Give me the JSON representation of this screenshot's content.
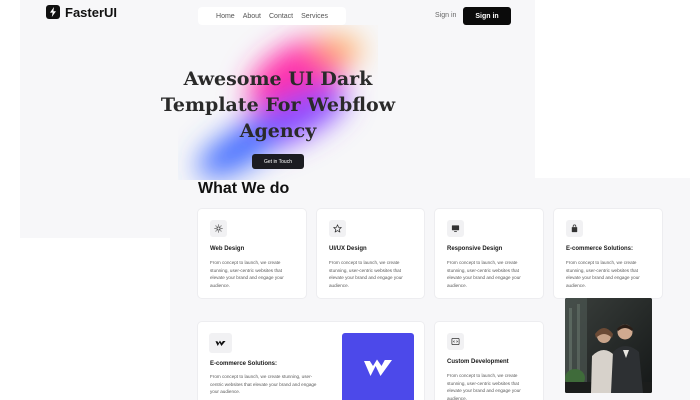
{
  "header": {
    "logo_text": "FasterUI",
    "nav": [
      "Home",
      "About",
      "Contact",
      "Services"
    ],
    "signin_link": "Sign in",
    "signin_button": "Sign in"
  },
  "hero": {
    "title": "Awesome UI Dark Template For Webflow Agency",
    "cta": "Get in Touch"
  },
  "services": {
    "title": "What We do",
    "cards": [
      {
        "icon": "sun-icon",
        "title": "Web Design",
        "desc": "From concept to launch, we create stunning, user-centric websites that elevate your brand and engage your audience."
      },
      {
        "icon": "star-icon",
        "title": "UI/UX Design",
        "desc": "From concept to launch, we create stunning, user-centric websites that elevate your brand and engage your audience."
      },
      {
        "icon": "monitor-icon",
        "title": "Responsive Design",
        "desc": "From concept to launch, we create stunning, user-centric websites that elevate your brand and engage your audience."
      },
      {
        "icon": "shopping-bag-icon",
        "title": "E-commerce Solutions:",
        "desc": "From concept to launch, we create stunning, user-centric websites that elevate your brand and engage your audience."
      },
      {
        "icon": "webflow-icon",
        "title": "E-commerce Solutions:",
        "desc": "From concept to launch, we create stunning, user-centric websites that elevate your brand and engage your audience."
      },
      {
        "icon": "code-icon",
        "title": "Custom Development",
        "desc": "From concept to launch, we create stunning, user-centric websites that elevate your brand and engage your audience."
      }
    ]
  },
  "colors": {
    "primary_dark": "#0b0b0b",
    "webflow_blue": "#4c49ea",
    "hero_pink": "#ff2fa8",
    "hero_blue": "#3f6bff",
    "hero_orange": "#ffb35a"
  }
}
